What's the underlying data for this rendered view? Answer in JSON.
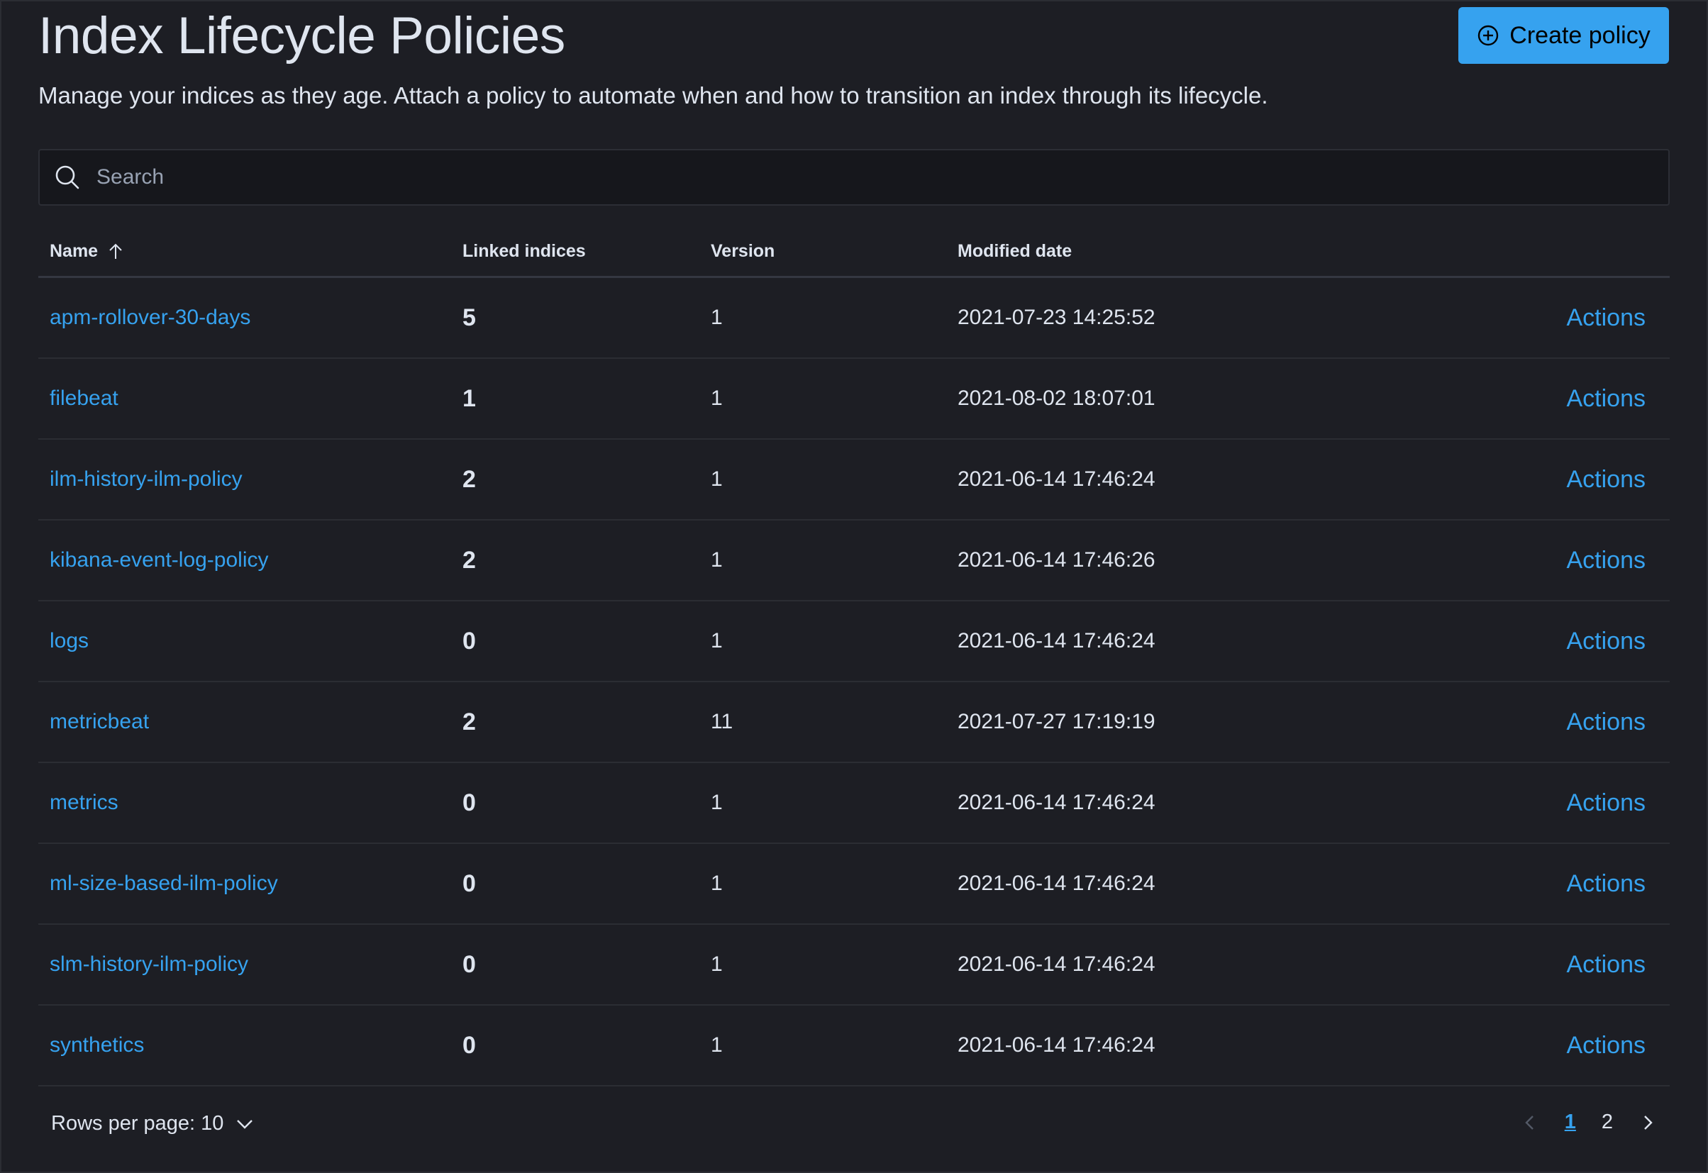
{
  "header": {
    "title": "Index Lifecycle Policies",
    "subtitle": "Manage your indices as they age. Attach a policy to automate when and how to transition an index through its lifecycle.",
    "create_button_label": "Create policy",
    "create_button_icon": "plus-in-circle-icon"
  },
  "search": {
    "placeholder": "Search",
    "value": ""
  },
  "table": {
    "columns": {
      "name": "Name",
      "linked": "Linked indices",
      "version": "Version",
      "modified": "Modified date"
    },
    "sort": {
      "column": "name",
      "direction": "ascending",
      "icon": "arrow-up-icon"
    },
    "rows": [
      {
        "name": "apm-rollover-30-days",
        "linked": "5",
        "version": "1",
        "modified": "2021-07-23 14:25:52",
        "actions": "Actions"
      },
      {
        "name": "filebeat",
        "linked": "1",
        "version": "1",
        "modified": "2021-08-02 18:07:01",
        "actions": "Actions"
      },
      {
        "name": "ilm-history-ilm-policy",
        "linked": "2",
        "version": "1",
        "modified": "2021-06-14 17:46:24",
        "actions": "Actions"
      },
      {
        "name": "kibana-event-log-policy",
        "linked": "2",
        "version": "1",
        "modified": "2021-06-14 17:46:26",
        "actions": "Actions"
      },
      {
        "name": "logs",
        "linked": "0",
        "version": "1",
        "modified": "2021-06-14 17:46:24",
        "actions": "Actions"
      },
      {
        "name": "metricbeat",
        "linked": "2",
        "version": "11",
        "modified": "2021-07-27 17:19:19",
        "actions": "Actions"
      },
      {
        "name": "metrics",
        "linked": "0",
        "version": "1",
        "modified": "2021-06-14 17:46:24",
        "actions": "Actions"
      },
      {
        "name": "ml-size-based-ilm-policy",
        "linked": "0",
        "version": "1",
        "modified": "2021-06-14 17:46:24",
        "actions": "Actions"
      },
      {
        "name": "slm-history-ilm-policy",
        "linked": "0",
        "version": "1",
        "modified": "2021-06-14 17:46:24",
        "actions": "Actions"
      },
      {
        "name": "synthetics",
        "linked": "0",
        "version": "1",
        "modified": "2021-06-14 17:46:24",
        "actions": "Actions"
      }
    ]
  },
  "footer": {
    "rows_per_page_label": "Rows per page: 10",
    "pages": [
      "1",
      "2"
    ],
    "current_page": "1"
  },
  "colors": {
    "background": "#1d1e24",
    "accent": "#36a2ef",
    "text": "#dfe5ef",
    "muted": "#98a2b3",
    "border": "#343741"
  }
}
